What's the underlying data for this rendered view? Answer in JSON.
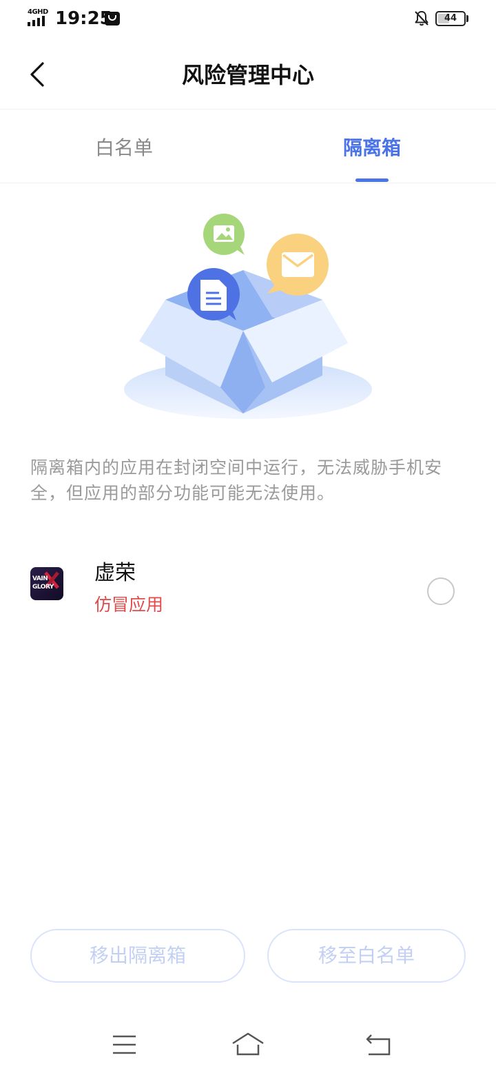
{
  "status_bar": {
    "network": "4GHD",
    "time": "19:25",
    "battery": "44",
    "battery_level": 0.44,
    "icons": [
      "signal-icon",
      "message-icon",
      "bell-off-icon",
      "battery-icon"
    ]
  },
  "header": {
    "title": "风险管理中心",
    "back_icon": "chevron-left-icon"
  },
  "tabs": [
    {
      "label": "白名单",
      "active": false
    },
    {
      "label": "隔离箱",
      "active": true
    }
  ],
  "illustration": {
    "icons": [
      "image-icon",
      "document-icon",
      "mail-icon",
      "open-box"
    ]
  },
  "description": "隔离箱内的应用在封闭空间中运行，无法威胁手机安全，但应用的部分功能可能无法使用。",
  "apps": [
    {
      "name": "虚荣",
      "tag": "仿冒应用",
      "icon_text": [
        "VAIN",
        "GLORY"
      ],
      "selected": false
    }
  ],
  "actions": {
    "remove_label": "移出隔离箱",
    "whitelist_label": "移至白名单"
  },
  "colors": {
    "accent": "#4b73e8",
    "warning": "#e04b4b",
    "muted": "#9a9a9a",
    "disabled_button_text": "#c2d0f4"
  },
  "nav_bar": {
    "icons": [
      "menu-icon",
      "home-icon",
      "back-icon"
    ]
  }
}
